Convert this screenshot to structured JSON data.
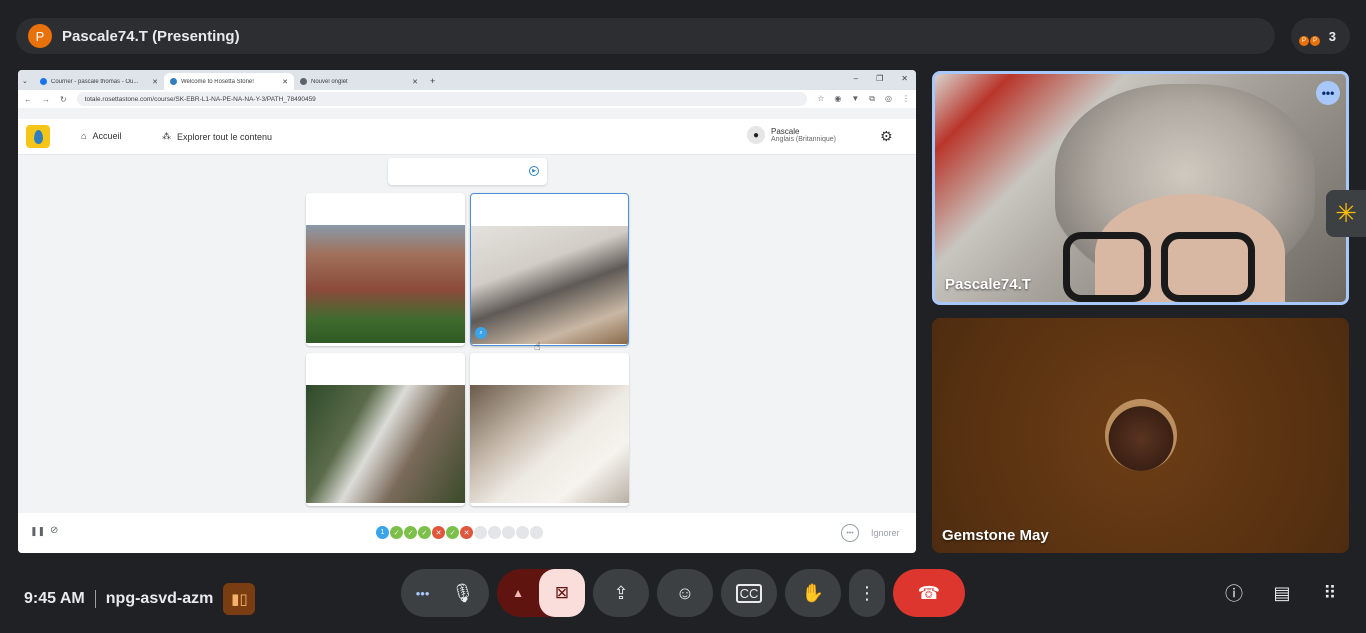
{
  "presenter": {
    "initial": "P",
    "label": "Pascale74.T (Presenting)"
  },
  "participants_pill": {
    "count": "3",
    "dots": [
      "P",
      "P"
    ]
  },
  "browser": {
    "tabs": [
      {
        "title": "Courrier - pascale thomas - Ou..."
      },
      {
        "title": "Welcome to Rosetta Stone!"
      },
      {
        "title": "Nouvel onglet"
      }
    ],
    "url": "totale.rosettastone.com/course/SK-EBR-L1-NA-PE-NA-NA-Y-3/PATH_78490459"
  },
  "app": {
    "nav_home": "Accueil",
    "nav_explore": "Explorer tout le contenu",
    "user_name": "Pascale",
    "user_language": "Anglais (Britannique)",
    "skip_label": "Ignorer",
    "progress": [
      {
        "label": "1",
        "state": "current"
      },
      {
        "label": "✓",
        "state": "correct"
      },
      {
        "label": "✓",
        "state": "correct"
      },
      {
        "label": "✓",
        "state": "correct"
      },
      {
        "label": "✕",
        "state": "wrong"
      },
      {
        "label": "✓",
        "state": "correct"
      },
      {
        "label": "✕",
        "state": "wrong"
      },
      {
        "label": "",
        "state": "todo"
      },
      {
        "label": "",
        "state": "todo"
      },
      {
        "label": "",
        "state": "todo"
      },
      {
        "label": "",
        "state": "todo"
      },
      {
        "label": "",
        "state": "todo"
      }
    ]
  },
  "tiles": {
    "self_name": "Pascale74.T",
    "other_name": "Gemstone May"
  },
  "meeting": {
    "time": "9:45 AM",
    "code": "npg-asvd-azm"
  },
  "colors": {
    "background": "#202124",
    "end_call": "#dc362e",
    "active_border": "#a8c7fa",
    "presenter_avatar": "#e8710a"
  },
  "icons": {
    "mic": "mic-icon",
    "camera_off": "camera-off-icon",
    "present": "present-screen-icon",
    "emoji": "emoji-icon",
    "captions": "captions-icon",
    "hand": "raise-hand-icon",
    "end": "end-call-icon"
  }
}
